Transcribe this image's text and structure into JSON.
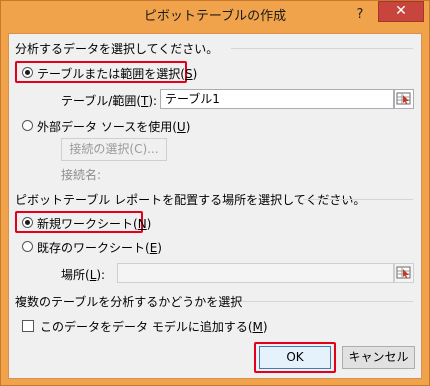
{
  "window": {
    "title": "ピボットテーブルの作成",
    "help_glyph": "?",
    "close_glyph": "✕"
  },
  "section1": {
    "heading": "分析するデータを選択してください。",
    "option_table": {
      "text": "テーブルまたは範囲を選択(",
      "key": "S",
      "close": ")",
      "checked": true
    },
    "range_label_text": "テーブル/範囲(",
    "range_label_key": "T",
    "range_label_close": "):",
    "range_value": "テーブル1",
    "option_external": {
      "text": "外部データ ソースを使用(",
      "key": "U",
      "close": ")",
      "checked": false
    },
    "connection_button": "接続の選択(C)...",
    "connection_name_label": "接続名:"
  },
  "section2": {
    "heading": "ピボットテーブル レポートを配置する場所を選択してください。",
    "option_new": {
      "text": "新規ワークシート(",
      "key": "N",
      "close": ")",
      "checked": true
    },
    "option_existing": {
      "text": "既存のワークシート(",
      "key": "E",
      "close": ")",
      "checked": false
    },
    "location_label_text": "場所(",
    "location_label_key": "L",
    "location_label_close": "):",
    "location_value": ""
  },
  "section3": {
    "heading": "複数のテーブルを分析するかどうかを選択",
    "add_to_model": {
      "text": "このデータをデータ モデルに追加する(",
      "key": "M",
      "close": ")",
      "checked": false
    }
  },
  "buttons": {
    "ok": "OK",
    "cancel": "キャンセル"
  },
  "colors": {
    "titlebar": "#f0a34a",
    "highlight": "#e2001a",
    "close_button": "#c7453d"
  }
}
